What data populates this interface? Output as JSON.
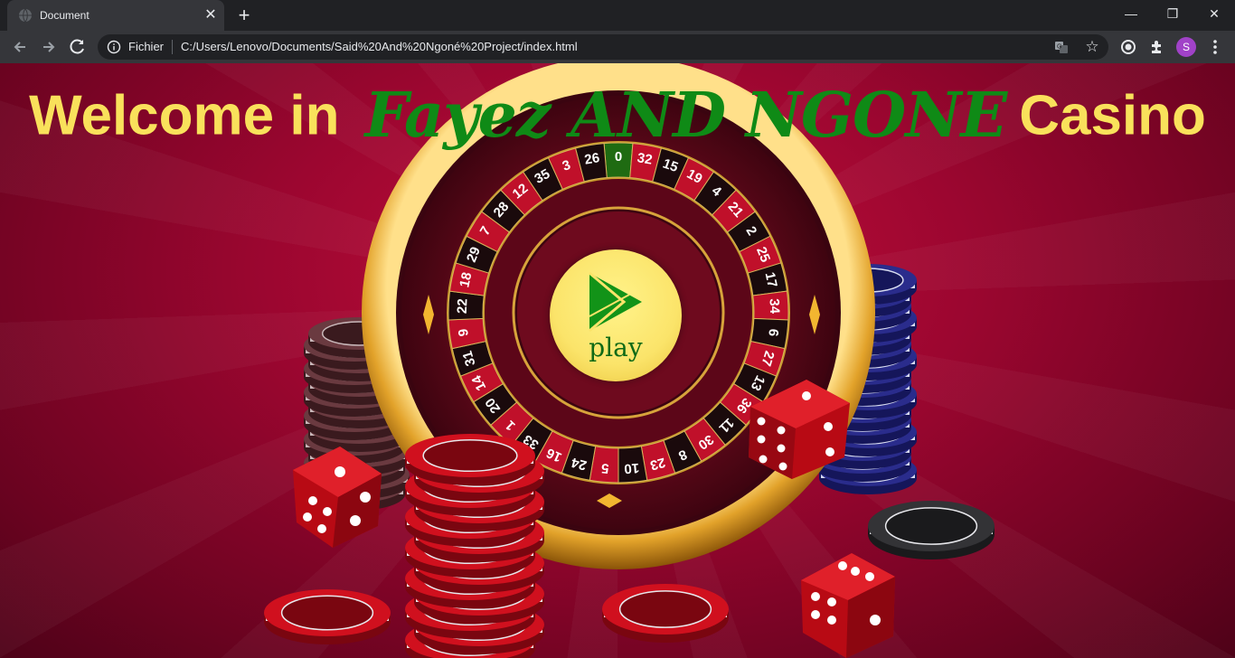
{
  "browser": {
    "tab_title": "Document",
    "scheme_label": "Fichier",
    "url": "C:/Users/Lenovo/Documents/Said%20And%20Ngoné%20Project/index.html",
    "profile_initial": "S"
  },
  "page": {
    "heading_prefix": "Welcome in",
    "heading_brand": "Fayez AND NGONE",
    "heading_suffix": "Casino",
    "play_label": "play"
  },
  "roulette": {
    "numbers": [
      "0",
      "32",
      "15",
      "19",
      "4",
      "21",
      "2",
      "25",
      "17",
      "34",
      "6",
      "27",
      "13",
      "36",
      "11",
      "30",
      "8",
      "23",
      "10",
      "5",
      "24",
      "16",
      "33",
      "1",
      "20",
      "14",
      "31",
      "9",
      "22",
      "18",
      "29",
      "7",
      "28",
      "12",
      "35",
      "3",
      "26"
    ]
  },
  "colors": {
    "heading_yellow": "#f9e15b",
    "brand_green": "#0f8a16",
    "background_red": "#b30a35",
    "gold": "#e6a21c"
  },
  "icons": {
    "back": "arrow-left-icon",
    "forward": "arrow-right-icon",
    "reload": "reload-icon",
    "info": "info-icon",
    "translate": "translate-icon",
    "bookmark": "star-icon",
    "extensions": "puzzle-icon",
    "menu": "kebab-menu-icon",
    "play": "play-triangle-icon"
  }
}
